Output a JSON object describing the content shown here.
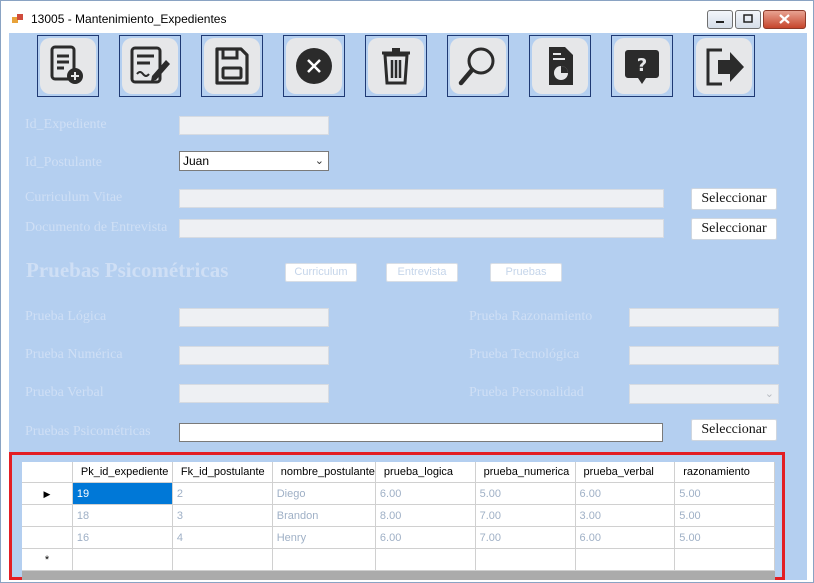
{
  "window": {
    "title": "13005 - Mantenimiento_Expedientes"
  },
  "toolbar": [
    {
      "name": "new-record-icon"
    },
    {
      "name": "edit-record-icon"
    },
    {
      "name": "save-icon"
    },
    {
      "name": "cancel-icon"
    },
    {
      "name": "delete-icon"
    },
    {
      "name": "search-icon"
    },
    {
      "name": "report-icon"
    },
    {
      "name": "help-icon"
    },
    {
      "name": "exit-icon"
    }
  ],
  "form": {
    "id_expediente_label": "Id_Expediente",
    "id_postulante_label": "Id_Postulante",
    "id_postulante_value": "Juan",
    "curriculum_label": "Curriculum Vitae",
    "entrevista_label": "Documento de Entrevista",
    "select_label": "Seleccionar",
    "section_title": "Pruebas Psicométricas",
    "btn_curriculum": "Curriculum",
    "btn_entrevista": "Entrevista",
    "btn_pruebas": "Pruebas",
    "prueba_logica_label": "Prueba Lógica",
    "prueba_numerica_label": "Prueba Numérica",
    "prueba_verbal_label": "Prueba Verbal",
    "pruebas_psicometricas_label": "Pruebas Psicométricas",
    "prueba_razonamiento_label": "Prueba Razonamiento",
    "prueba_tecnologica_label": "Prueba Tecnológica",
    "prueba_personalidad_label": "Prueba Personalidad"
  },
  "grid": {
    "columns": [
      "Pk_id_expediente",
      "Fk_id_postulante",
      "nombre_postulante",
      "prueba_logica",
      "prueba_numerica",
      "prueba_verbal",
      "razonamiento"
    ],
    "rows": [
      [
        "19",
        "2",
        "Diego",
        "6.00",
        "5.00",
        "6.00",
        "5.00"
      ],
      [
        "18",
        "3",
        "Brandon",
        "8.00",
        "7.00",
        "3.00",
        "5.00"
      ],
      [
        "16",
        "4",
        "Henry",
        "6.00",
        "7.00",
        "6.00",
        "5.00"
      ]
    ],
    "new_row_marker": "*",
    "current_row_marker": "▶"
  },
  "colors": {
    "accent": "#e31e24",
    "form_bg": "#b4cff0",
    "selection": "#0078d7"
  }
}
